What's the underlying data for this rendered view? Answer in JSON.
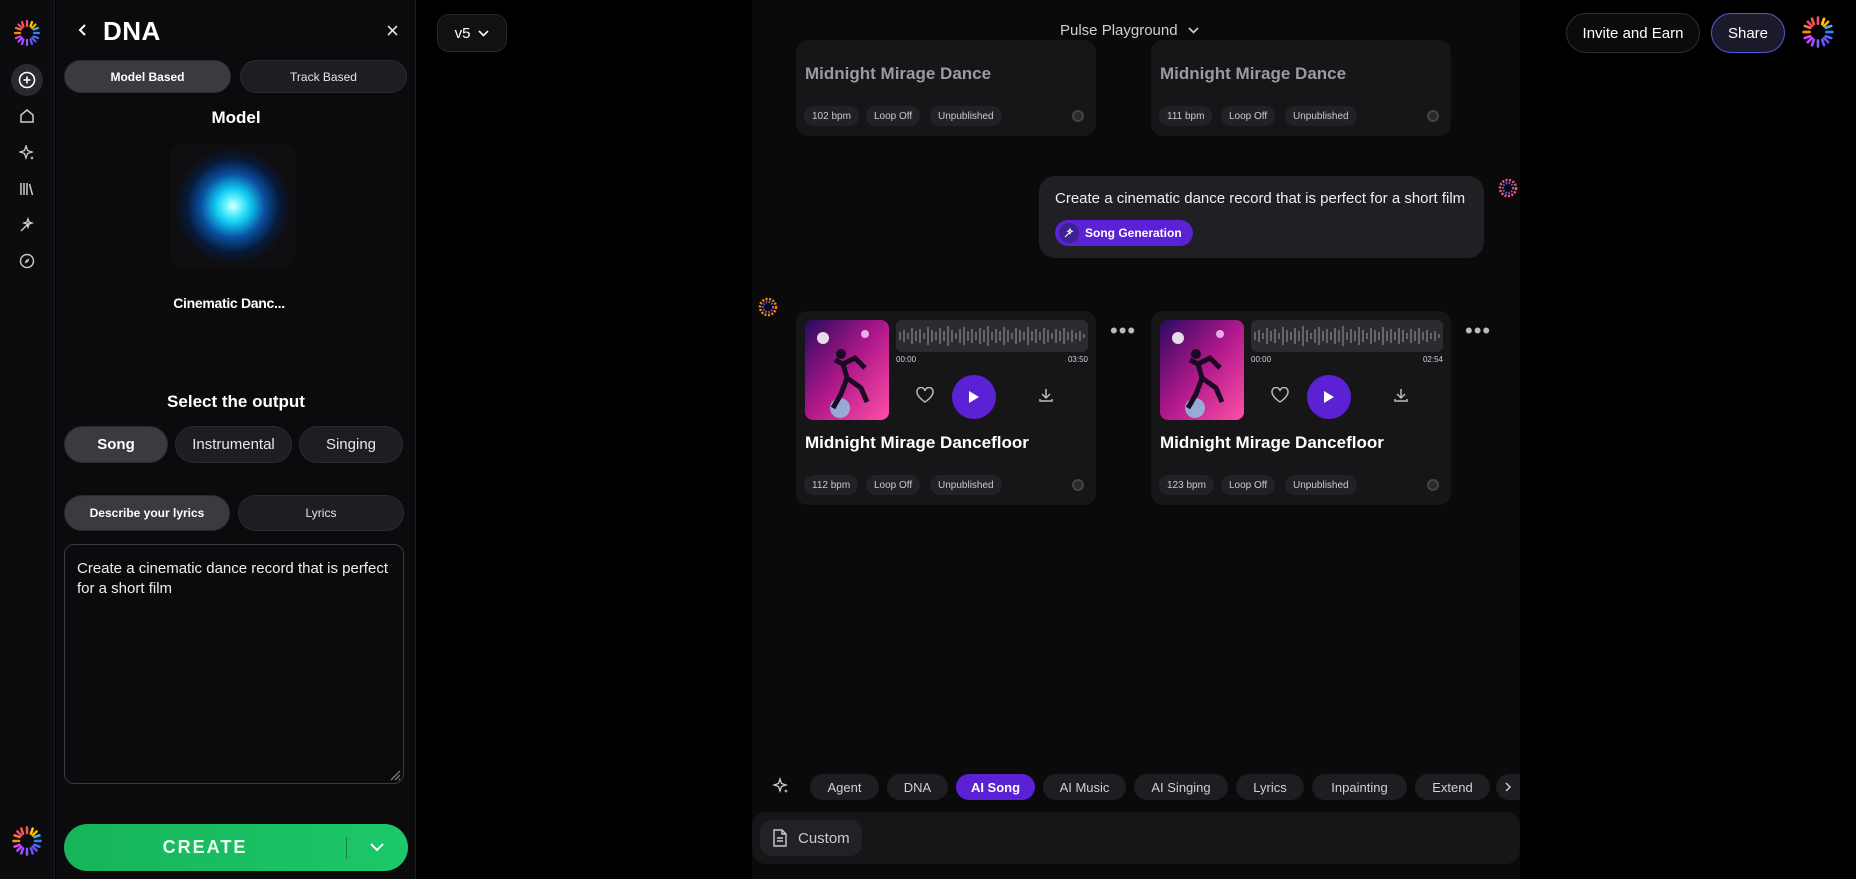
{
  "rail": {
    "items": [
      "add",
      "home",
      "sparkle",
      "library",
      "magic",
      "compass"
    ]
  },
  "panel": {
    "title": "DNA",
    "mode_tabs": [
      "Model Based",
      "Track Based"
    ],
    "model_heading": "Model",
    "model_name": "Cinematic Danc...",
    "output_heading": "Select the output",
    "output_options": [
      "Song",
      "Instrumental",
      "Singing"
    ],
    "lyric_tabs": [
      "Describe your lyrics",
      "Lyrics"
    ],
    "prompt": "Create a cinematic dance record that is perfect for a short film",
    "create_label": "CREATE"
  },
  "topbar": {
    "version": "v5",
    "playground": "Pulse Playground",
    "invite": "Invite and Earn",
    "share": "Share"
  },
  "top_cards": [
    {
      "name": "Midnight Mirage Dance",
      "bpm": "102 bpm",
      "loop": "Loop Off",
      "status": "Unpublished"
    },
    {
      "name": "Midnight Mirage Dance",
      "bpm": "111 bpm",
      "loop": "Loop Off",
      "status": "Unpublished"
    }
  ],
  "bubble": {
    "message": "Create a cinematic dance record that is perfect for a short film",
    "chip": "Song Generation"
  },
  "result_cards": [
    {
      "name": "Midnight Mirage Dancefloor",
      "start": "00:00",
      "end": "03:50",
      "bpm": "112 bpm",
      "loop": "Loop Off",
      "status": "Unpublished"
    },
    {
      "name": "Midnight Mirage Dancefloor",
      "start": "00:00",
      "end": "02:54",
      "bpm": "123 bpm",
      "loop": "Loop Off",
      "status": "Unpublished"
    }
  ],
  "bottom_tabs": [
    "Agent",
    "DNA",
    "AI Song",
    "AI Music",
    "AI Singing",
    "Lyrics",
    "Inpainting",
    "Extend"
  ],
  "input": {
    "custom": "Custom"
  }
}
